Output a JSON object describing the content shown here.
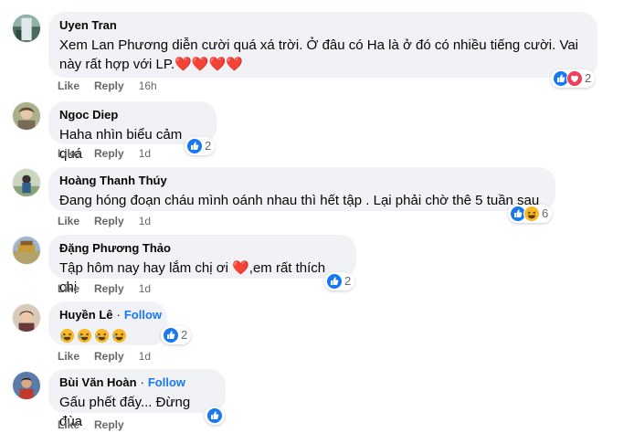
{
  "comments": [
    {
      "author": "Uyen Tran",
      "text": "Xem Lan Phương diễn cười quá xá trời. Ở đâu có Ha là ở đó có nhiều tiếng cười. Vai này rất hợp với LP.",
      "text_suffix": "❤️❤️❤️❤️",
      "like": "Like",
      "reply": "Reply",
      "time": "16h",
      "reactions": [
        "like-icon",
        "love-icon"
      ],
      "reaction_count": "2"
    },
    {
      "author": "Ngoc Diep",
      "text": "Haha nhìn biểu cảm quá",
      "like": "Like",
      "reply": "Reply",
      "time": "1d",
      "reactions": [
        "like-icon"
      ],
      "reaction_count": "2"
    },
    {
      "author": "Hoàng Thanh Thúy",
      "text": "Đang hóng đoạn cháu mình oánh nhau thì hết tập . Lại phải chờ thê 5 tuần sau",
      "like": "Like",
      "reply": "Reply",
      "time": "1d",
      "reactions": [
        "like-icon",
        "haha-icon"
      ],
      "reaction_count": "6"
    },
    {
      "author": "Đặng Phương Thảo",
      "text_before": "Tập hôm nay hay lắm chị ơi ",
      "text_heart": "❤️",
      "text_after": ",em rất thích chị",
      "like": "Like",
      "reply": "Reply",
      "time": "1d",
      "reactions": [
        "like-icon"
      ],
      "reaction_count": "2"
    },
    {
      "author": "Huyền Lê",
      "separator": "·",
      "follow": "Follow",
      "emojis": [
        "laughing-emoji",
        "laughing-emoji",
        "laughing-emoji",
        "laughing-emoji"
      ],
      "like": "Like",
      "reply": "Reply",
      "time": "1d",
      "reactions": [
        "like-icon"
      ],
      "reaction_count": "2"
    },
    {
      "author": "Bùi Văn Hoàn",
      "separator": "·",
      "follow": "Follow",
      "text": "Gấu phết đấy... Đừng đùa",
      "like": "Like",
      "reply": "Reply",
      "reactions": [
        "like-icon"
      ]
    }
  ],
  "colors": {
    "bubble": "#f0f2f5",
    "link_blue": "#1877f2",
    "secondary_text": "#65676b",
    "heart_red": "#e0245e"
  }
}
